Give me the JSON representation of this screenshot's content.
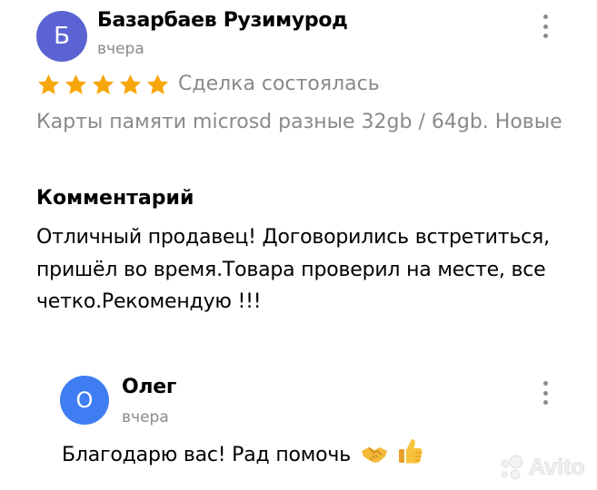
{
  "review": {
    "avatar_letter": "Б",
    "author": "Базарбаев Рузимурод",
    "date": "вчера",
    "rating": 5,
    "deal_status": "Сделка состоялась",
    "product": "Карты памяти microsd разные 32gb / 64gb. Новые",
    "comment_title": "Комментарий",
    "comment": "Отличный продавец! Договорились встретиться, пришёл во время.Товара проверил на месте, все четко.Рекомендую !!!"
  },
  "reply": {
    "avatar_letter": "О",
    "author": "Олег",
    "date": "вчера",
    "text": "Благодарю вас! Рад помочь"
  },
  "icons": {
    "star": "star-icon",
    "more": "more-vertical-icon",
    "handshake": "handshake-emoji",
    "thumbs_up": "thumbs-up-emoji"
  },
  "watermark": "Avito",
  "colors": {
    "star": "#f7a70b",
    "avatar_main": "#5b63d3",
    "avatar_reply": "#3f7ef2",
    "muted_text": "#8a8a8a"
  }
}
